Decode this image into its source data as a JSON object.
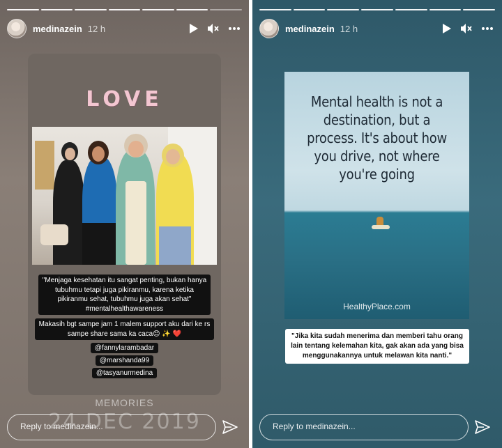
{
  "left_story": {
    "username": "medinazein",
    "time": "12 h",
    "love_title": "LOVE",
    "caption": {
      "quote_lines": [
        "\"Menjaga kesehatan itu sangat penting, bukan hanya",
        "tubuhmu tetapi juga pikiranmu, karena ketika",
        "pikiranmu sehat, tubuhmu juga akan sehat\"",
        "#mentalhealthawareness"
      ],
      "thanks_lines": [
        "Makasih bgt sampe jam 1 malem support aku dari ke rs",
        "sampe share sama ka caca😊 ✨ ❤️"
      ],
      "tags": [
        "@fannylarambadar",
        "@marshanda99",
        "@tasyanurmedina"
      ]
    },
    "memories_label": "MEMORIES",
    "date": "24 DEC 2019",
    "reply_placeholder": "Reply to medinazein..."
  },
  "right_story": {
    "username": "medinazein",
    "time": "12 h",
    "quote_lines": [
      "Mental health is not a",
      "destination, but a",
      "process. It's about how",
      "you drive, not where",
      "you're going"
    ],
    "watermark": "HealthyPlace.com",
    "caption_lines": [
      "\"Jika kita sudah menerima dan memberi tahu orang",
      "lain tentang kelemahan kita, gak akan ada yang bisa",
      "menggunakannya untuk melawan kita nanti.\""
    ],
    "reply_placeholder": "Reply to medinazein..."
  },
  "icons": {
    "play": "play-icon",
    "mute": "mute-icon",
    "more": "more-icon",
    "send": "send-icon"
  }
}
